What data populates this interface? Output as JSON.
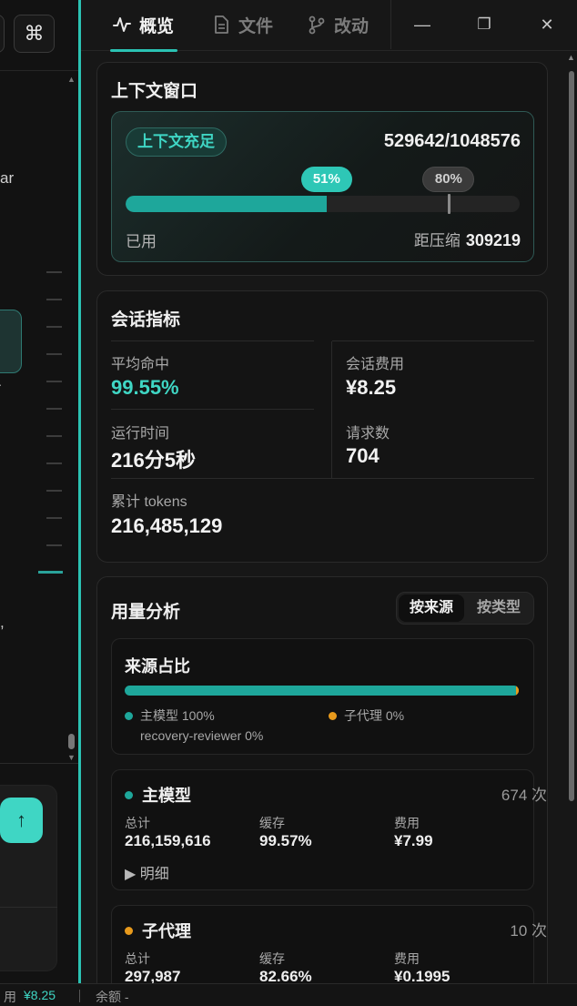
{
  "left": {
    "cmd_glyph": "⌘",
    "frag_ar": "ar",
    "frag_dot": "·",
    "frag_comma": ",",
    "send_glyph": "↑"
  },
  "status": {
    "label": "用",
    "cost": "¥8.25",
    "balance": "余额 -"
  },
  "tabs": [
    {
      "label": "概览",
      "active": true
    },
    {
      "label": "文件",
      "active": false
    },
    {
      "label": "改动",
      "active": false
    }
  ],
  "window_controls": {
    "minimize": "—",
    "maximize": "❐",
    "close": "✕"
  },
  "context": {
    "title": "上下文窗口",
    "status_badge": "上下文充足",
    "tokens_used": "529642/1048576",
    "used_percent": 51,
    "used_percent_label": "51%",
    "threshold_percent": 80,
    "threshold_label": "80%",
    "used_label": "已用",
    "compress_label": "距压缩",
    "compress_value": "309219"
  },
  "metrics": {
    "title": "会话指标",
    "avg_hit_label": "平均命中",
    "avg_hit_value": "99.55%",
    "cost_label": "会话费用",
    "cost_value": "¥8.25",
    "runtime_label": "运行时间",
    "runtime_value": "216分5秒",
    "requests_label": "请求数",
    "requests_value": "704",
    "tokens_label": "累计 tokens",
    "tokens_value": "216,485,129"
  },
  "usage": {
    "title": "用量分析",
    "toggle_on": "按来源",
    "toggle_off": "按类型",
    "source_share_title": "来源占比",
    "legend": [
      {
        "label": "主模型 100%",
        "color": "#1ea79b"
      },
      {
        "label": "子代理 0%",
        "color": "#e89a1c"
      },
      {
        "label": "recovery-reviewer 0%",
        "color": ""
      }
    ],
    "share_main_percent": 99.3,
    "models": [
      {
        "name": "主模型",
        "color": "#1ea79b",
        "count": "674 次",
        "total_label": "总计",
        "total": "216,159,616",
        "cache_label": "缓存",
        "cache": "99.57%",
        "cost_label": "费用",
        "cost": "¥7.99",
        "detail": "▶ 明细"
      },
      {
        "name": "子代理",
        "color": "#e89a1c",
        "count": "10 次",
        "total_label": "总计",
        "total": "297,987",
        "cache_label": "缓存",
        "cache": "82.66%",
        "cost_label": "费用",
        "cost": "¥0.1995"
      }
    ]
  }
}
